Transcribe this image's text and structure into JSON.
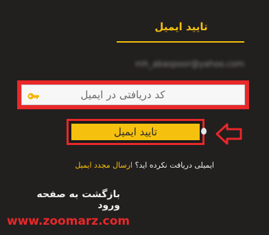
{
  "tab": {
    "title": "تایید ایمیل"
  },
  "email_blurred": "mh_abaspoor@yahoo.com",
  "code_field": {
    "placeholder": "کد دریافتی در ایمیل",
    "icon": "key-icon"
  },
  "confirm_button": {
    "label": "تایید ایمیل"
  },
  "resend": {
    "question": "ایمیلی دریافت نکرده اید؟",
    "link": "ارسال مجدد ایمیل"
  },
  "back_link": "بازگشت به صفحه ورود",
  "watermark": "www.zoomarz.com",
  "colors": {
    "accent": "#f5c10e",
    "highlight": "#e8282a",
    "background": "#221f1f"
  }
}
